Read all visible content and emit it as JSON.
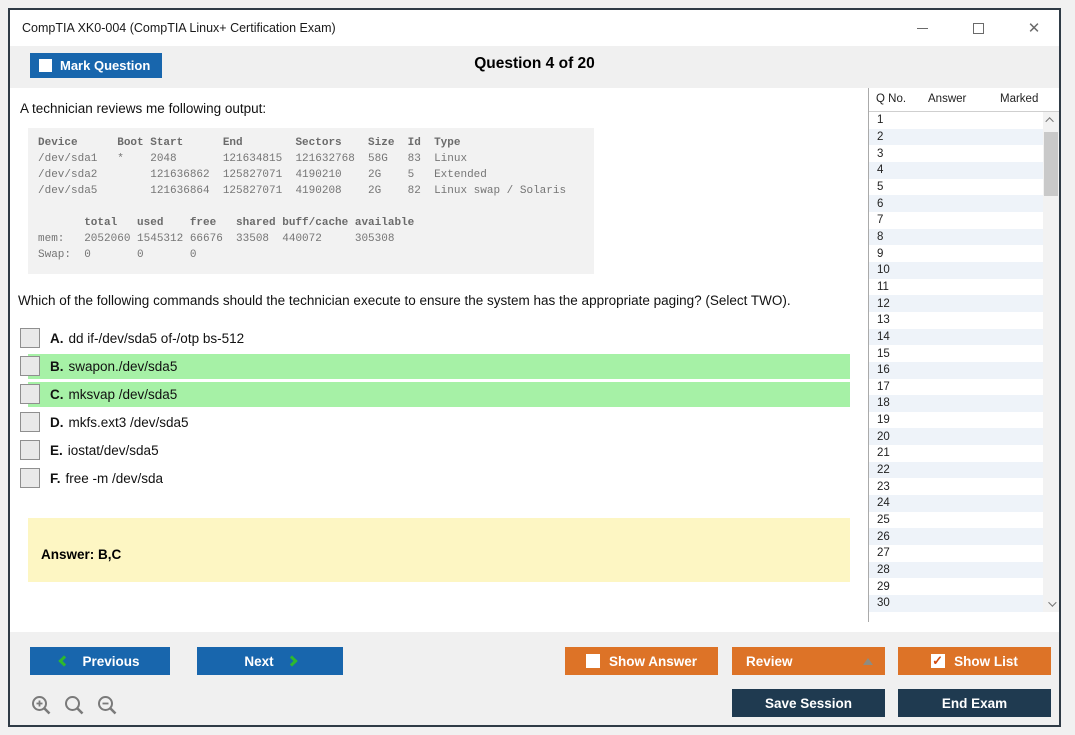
{
  "window": {
    "title": "CompTIA XK0-004 (CompTIA Linux+ Certification Exam)"
  },
  "header": {
    "mark_question_label": "Mark Question",
    "question_counter": "Question 4 of 20"
  },
  "question": {
    "intro": "A technician reviews me following output:",
    "code_lines": [
      {
        "text": "Device      Boot Start      End        Sectors    Size  Id  Type",
        "bold": true
      },
      {
        "text": "/dev/sda1   *    2048       121634815  121632768  58G   83  Linux",
        "bold": false
      },
      {
        "text": "/dev/sda2        121636862  125827071  4190210    2G    5   Extended",
        "bold": false
      },
      {
        "text": "/dev/sda5        121636864  125827071  4190208    2G    82  Linux swap / Solaris",
        "bold": false
      },
      {
        "text": " ",
        "bold": false
      },
      {
        "text": "       total   used    free   shared buff/cache available",
        "bold": true
      },
      {
        "text": "mem:   2052060 1545312 66676  33508  440072     305308",
        "bold": false
      },
      {
        "text": "Swap:  0       0       0",
        "bold": false
      }
    ],
    "prompt": "Which of the following commands should the technician execute to ensure the system has the appropriate paging? (Select TWO).",
    "options": [
      {
        "letter": "A.",
        "text": "dd if-/dev/sda5 of-/otp bs-512",
        "highlighted": false
      },
      {
        "letter": "B.",
        "text": "swapon./dev/sda5",
        "highlighted": true
      },
      {
        "letter": "C.",
        "text": "mksvap /dev/sda5",
        "highlighted": true
      },
      {
        "letter": "D.",
        "text": "mkfs.ext3 /dev/sda5",
        "highlighted": false
      },
      {
        "letter": "E.",
        "text": "iostat/dev/sda5",
        "highlighted": false
      },
      {
        "letter": "F.",
        "text": "free -m /dev/sda",
        "highlighted": false
      }
    ],
    "answer_label": "Answer: B,C"
  },
  "sidebar": {
    "columns": {
      "qno": "Q No.",
      "answer": "Answer",
      "marked": "Marked"
    },
    "rows": [
      "1",
      "2",
      "3",
      "4",
      "5",
      "6",
      "7",
      "8",
      "9",
      "10",
      "11",
      "12",
      "13",
      "14",
      "15",
      "16",
      "17",
      "18",
      "19",
      "20",
      "21",
      "22",
      "23",
      "24",
      "25",
      "26",
      "27",
      "28",
      "29",
      "30"
    ]
  },
  "footer": {
    "previous_label": "Previous",
    "next_label": "Next",
    "show_answer_label": "Show Answer",
    "review_label": "Review",
    "show_list_label": "Show List",
    "save_session_label": "Save Session",
    "end_exam_label": "End Exam"
  },
  "colors": {
    "accent_blue": "#1866ad",
    "accent_orange": "#dd7327",
    "navy": "#1f3a50",
    "highlight_green": "#a6f1a6",
    "answer_yellow": "#fdf6c3",
    "chevron_green": "#2eb82e",
    "band_gray": "#f0f0f0"
  }
}
